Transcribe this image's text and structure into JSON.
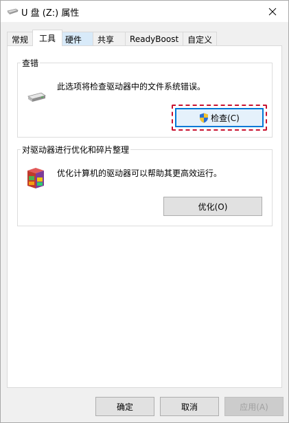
{
  "window": {
    "title": "U 盘 (Z:) 属性"
  },
  "tabs": [
    {
      "label": "常规"
    },
    {
      "label": "工具"
    },
    {
      "label": "硬件"
    },
    {
      "label": "共享"
    },
    {
      "label": "ReadyBoost"
    },
    {
      "label": "自定义"
    }
  ],
  "error_check": {
    "group_label": "查错",
    "description": "此选项将检查驱动器中的文件系统错误。",
    "button_label": "检查(C)"
  },
  "optimize": {
    "group_label": "对驱动器进行优化和碎片整理",
    "description": "优化计算机的驱动器可以帮助其更高效运行。",
    "button_label": "优化(O)"
  },
  "footer": {
    "ok_label": "确定",
    "cancel_label": "取消",
    "apply_label": "应用(A)"
  },
  "colors": {
    "highlight": "#c8102e",
    "focus_border": "#0078d7"
  }
}
